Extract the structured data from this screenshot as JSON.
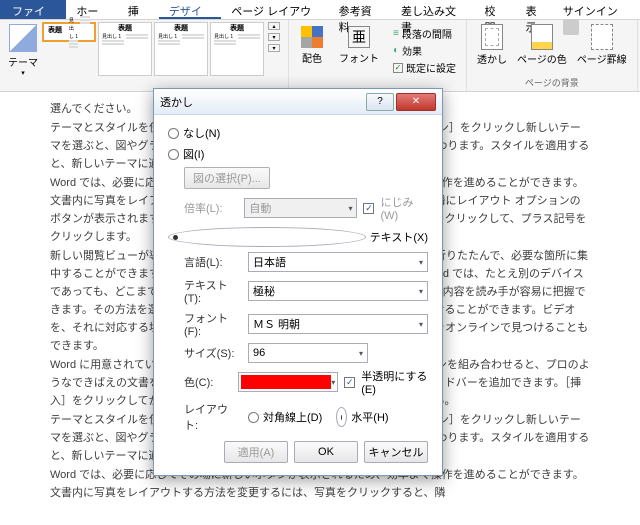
{
  "tabs": {
    "file": "ファイル",
    "home": "ホーム",
    "insert": "挿入",
    "design": "デザイン",
    "layout": "ページ レイアウト",
    "references": "参考資料",
    "mailings": "差し込み文書",
    "review": "校閲",
    "view": "表示",
    "signin": "サインイン"
  },
  "ribbon": {
    "themes_label": "テーマ",
    "gallery_title": "表題",
    "gallery_sub": "見出し 1",
    "colors": "配色",
    "fonts": "フォント",
    "font_glyph": "亜",
    "para_spacing": "段落の間隔",
    "effects": "効果",
    "set_default": "既定に設定",
    "watermark": "透かし",
    "page_color": "ページの色",
    "page_borders": "ページ罫線",
    "page_bg_label": "ページの背景"
  },
  "doc": {
    "p": [
      "選んでください。",
      "テーマとスタイルを使って、文書全体の統一感を出すこともできます。［デザイン］をクリックし新しいテーマを選ぶと、図やグラフ、SmartArt グラフィックが新しいテーマに合わせて変わります。スタイルを適用すると、新しいテーマに適合するように見出しが変更されます。",
      "Word では、必要に応じてその場に新しいボタンが表示されるため、効率よく操作を進めることができます。文書内に写真をレイアウトする方法を変更するには、写真をクリックすると、隣にレイアウト オプションのボタンが表示されます。表で作業している場合は、行または列を追加する場所をクリックして、プラス記号をクリックします。",
      "新しい閲覧ビューが導入されたため、閲覧も簡単になりました。文書の一部を折りたたんで、必要な箇所に集中することができます。最後まで読み終わる前に中止する必要がある場合、Word では、たとえ別のデバイスであっても、どこまで読んだかが記憶されます。最適な素材を使うと、伝えたい内容を読み手が容易に把握できます。その方法を選ぶだけで、作品にマッチしたビデオをオンラインで見つけることができます。ビデオを、それに対応する埋め込み用のキーワードを入力して、作品に最適なビデオをオンラインで見つけることもできます。",
      "Word に用意されているヘッダー、フッター、表紙、テキスト ボックス デザインを組み合わせると、プロのようなできばえの文書を作成できます。たとえば、一致する表紙、ヘッダー、サイドバーを追加できます。［挿入］をクリックしてから、それぞれのギャラリーで目的の要素を選んでください。",
      "テーマとスタイルを使って、文書全体の統一感を出すこともできます。［デザイン］をクリックし新しいテーマを選ぶと、図やグラフ、SmartArt グラフィックが新しいテーマに合わせて変わります。スタイルを適用すると、新しいテーマに適合するように見出しが変更されます。",
      "Word では、必要に応じてその場に新しいボタンが表示されるため、効率よく操作を進めることができます。文書内に写真をレイアウトする方法を変更するには、写真をクリックすると、隣"
    ]
  },
  "dialog": {
    "title": "透かし",
    "none": "なし(N)",
    "picture": "図(I)",
    "select_pic": "図の選択(P)...",
    "scale": "倍率(L):",
    "scale_val": "自動",
    "washout": "にじみ(W)",
    "text_wm": "テキスト(X)",
    "language": "言語(L):",
    "language_val": "日本語",
    "text": "テキスト(T):",
    "text_val": "極秘",
    "font": "フォント(F):",
    "font_val": "ＭＳ 明朝",
    "size": "サイズ(S):",
    "size_val": "96",
    "color": "色(C):",
    "semi": "半透明にする(E)",
    "layout": "レイアウト:",
    "diagonal": "対角線上(D)",
    "horizontal": "水平(H)",
    "apply": "適用(A)",
    "ok": "OK",
    "cancel": "キャンセル"
  }
}
